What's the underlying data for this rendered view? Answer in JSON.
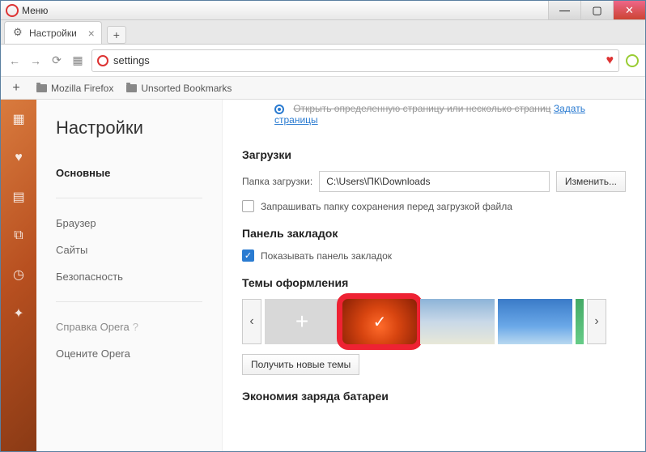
{
  "titlebar": {
    "menu": "Меню"
  },
  "tab": {
    "title": "Настройки"
  },
  "address": {
    "value": "settings"
  },
  "bookmarks": {
    "folder1": "Mozilla Firefox",
    "folder2": "Unsorted Bookmarks"
  },
  "sidebar": {
    "title": "Настройки",
    "items": {
      "basic": "Основные",
      "browser": "Браузер",
      "sites": "Сайты",
      "security": "Безопасность",
      "help": "Справка Opera",
      "rate": "Оцените Opera"
    }
  },
  "top_link": {
    "text": "Открыть определенную страницу или несколько страниц",
    "link": "Задать страницы"
  },
  "downloads": {
    "heading": "Загрузки",
    "folder_label": "Папка загрузки:",
    "folder_value": "C:\\Users\\ПК\\Downloads",
    "change_btn": "Изменить...",
    "ask_checkbox": "Запрашивать папку сохранения перед загрузкой файла"
  },
  "bookmarks_panel": {
    "heading": "Панель закладок",
    "show_checkbox": "Показывать панель закладок"
  },
  "themes": {
    "heading": "Темы оформления",
    "get_more_btn": "Получить новые темы"
  },
  "battery": {
    "heading": "Экономия заряда батареи"
  }
}
